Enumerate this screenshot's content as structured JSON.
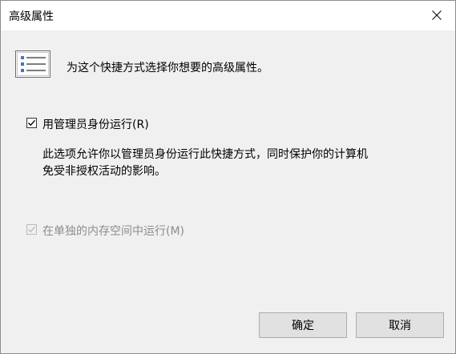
{
  "window": {
    "title": "高级属性"
  },
  "header": {
    "icon": "checklist-icon",
    "text": "为这个快捷方式选择你想要的高级属性。"
  },
  "options": {
    "run_as_admin": {
      "label": "用管理员身份运行(R)",
      "checked": true,
      "enabled": true,
      "description_line1": "此选项允许你以管理员身份运行此快捷方式，同时保护你的计算机",
      "description_line2": "免受非授权活动的影响。"
    },
    "run_separate_memory": {
      "label": "在单独的内存空间中运行(M)",
      "checked": true,
      "enabled": false
    }
  },
  "buttons": {
    "ok_label": "确定",
    "cancel_label": "取消"
  },
  "colors": {
    "dialog_bg": "#f0f0f0",
    "titlebar_bg": "#ffffff",
    "disabled_text": "#8d8d8d",
    "button_bg": "#e1e1e1"
  }
}
